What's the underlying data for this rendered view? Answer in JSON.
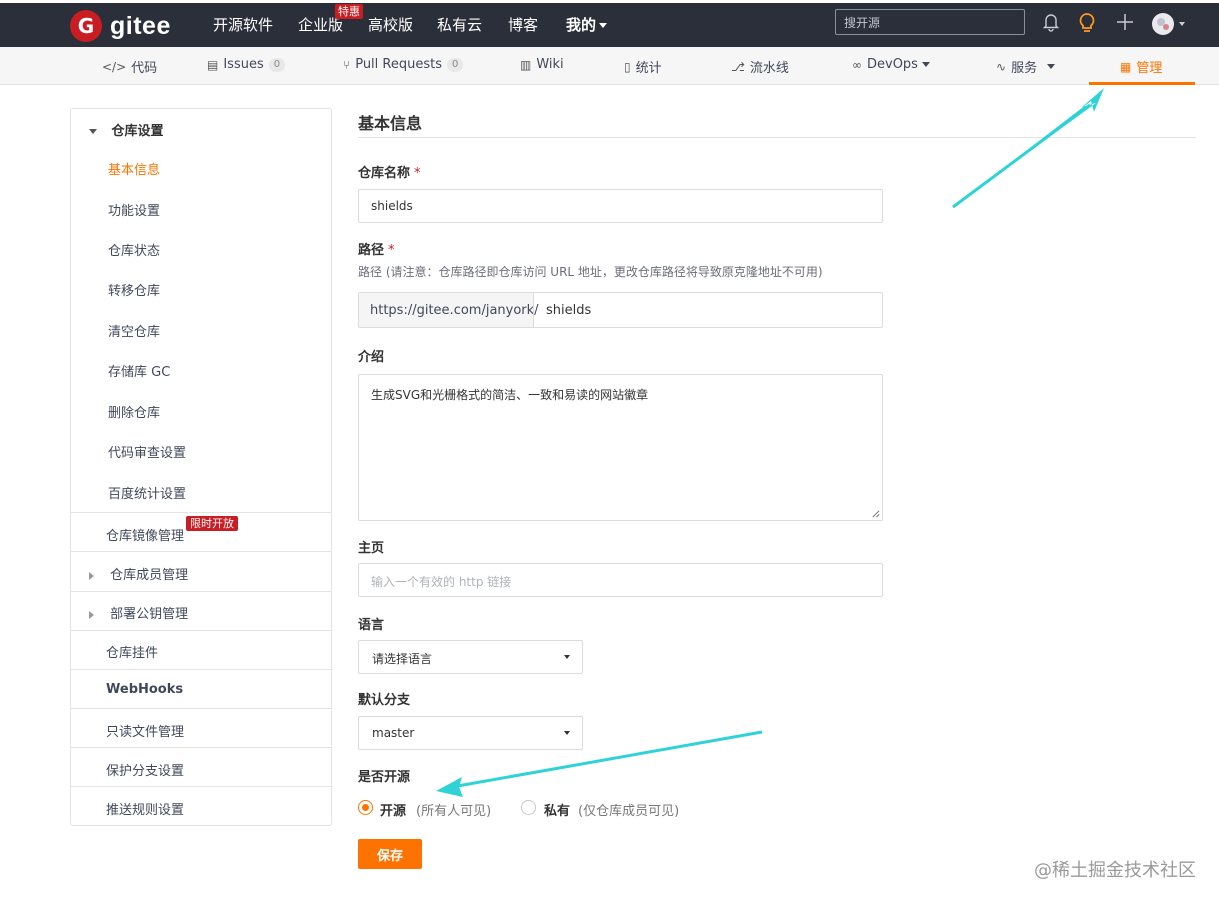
{
  "topbar": {
    "logo_letter": "G",
    "logo_text": "gitee",
    "nav": [
      "开源软件",
      "企业版",
      "高校版",
      "私有云",
      "博客",
      "我的"
    ],
    "enterprise_badge": "特惠",
    "search_placeholder": "搜开源",
    "icons": [
      "bell-icon",
      "lightbulb-icon",
      "plus-icon",
      "avatar"
    ],
    "accent": "#fe7300",
    "bg": "#2b2f3a"
  },
  "subnav": {
    "tabs": [
      {
        "icon": "</>",
        "label": "代码"
      },
      {
        "icon": "▤",
        "label": "Issues",
        "count": "0"
      },
      {
        "icon": "⑂",
        "label": "Pull Requests",
        "count": "0"
      },
      {
        "icon": "▥",
        "label": "Wiki"
      },
      {
        "icon": "▯",
        "label": "统计"
      },
      {
        "icon": "⎇",
        "label": "流水线"
      },
      {
        "icon": "∞",
        "label": "DevOps"
      },
      {
        "icon": "∿",
        "label": "服务"
      },
      {
        "icon": "▦",
        "label": "管理"
      }
    ],
    "active_tab": "管理"
  },
  "sidebar": {
    "group_title": "仓库设置",
    "sub_items": [
      "基本信息",
      "功能设置",
      "仓库状态",
      "转移仓库",
      "清空仓库",
      "存储库 GC",
      "删除仓库",
      "代码审查设置",
      "百度统计设置"
    ],
    "active_item": "基本信息",
    "mirror": "仓库镜像管理",
    "mirror_badge": "限时开放",
    "members": "仓库成员管理",
    "deploy_keys": "部署公钥管理",
    "widgets": "仓库挂件",
    "webhooks": "WebHooks",
    "readonly": "只读文件管理",
    "protected": "保护分支设置",
    "push_rules": "推送规则设置"
  },
  "form": {
    "title": "基本信息",
    "name_label": "仓库名称",
    "name_value": "shields",
    "required_mark": "*",
    "path_label": "路径",
    "path_hint": "路径 (请注意：仓库路径即仓库访问 URL 地址，更改仓库路径将导致原克隆地址不可用)",
    "path_prefix": "https://gitee.com/janyork/",
    "path_value": "shields",
    "intro_label": "介绍",
    "intro_value": "生成SVG和光栅格式的简洁、一致和易读的网站徽章",
    "homepage_label": "主页",
    "homepage_placeholder": "输入一个有效的 http 链接",
    "language_label": "语言",
    "language_value": "请选择语言",
    "branch_label": "默认分支",
    "branch_value": "master",
    "visibility_label": "是否开源",
    "public_label": "开源",
    "public_note": "(所有人可见)",
    "private_label": "私有",
    "private_note": "(仅仓库成员可见)",
    "selected_visibility": "开源",
    "save_label": "保存"
  },
  "watermark": "@稀土掘金技术社区",
  "annotation_color": "#2fd3d6"
}
